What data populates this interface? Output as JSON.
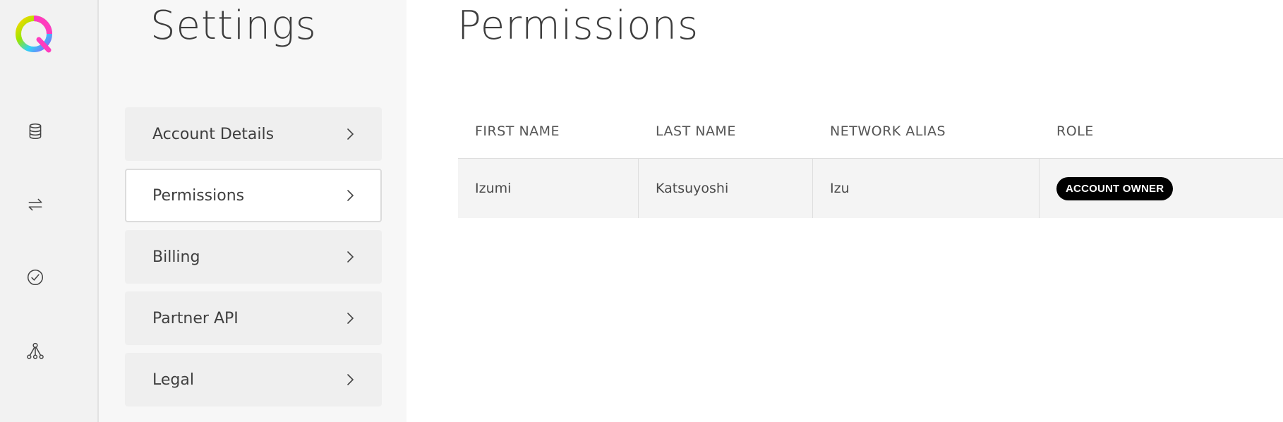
{
  "rail": {
    "icons": [
      "database-icon",
      "transfer-arrows-icon",
      "check-circle-icon",
      "network-icon"
    ]
  },
  "settings": {
    "title": "Settings",
    "items": [
      {
        "label": "Account Details",
        "active": false
      },
      {
        "label": "Permissions",
        "active": true
      },
      {
        "label": "Billing",
        "active": false
      },
      {
        "label": "Partner API",
        "active": false
      },
      {
        "label": "Legal",
        "active": false
      }
    ]
  },
  "main": {
    "title": "Permissions",
    "table": {
      "headers": [
        "FIRST NAME",
        "LAST NAME",
        "NETWORK ALIAS",
        "ROLE"
      ],
      "rows": [
        {
          "first_name": "Izumi",
          "last_name": "Katsuyoshi",
          "network_alias": "Izu",
          "role": "ACCOUNT OWNER"
        }
      ]
    }
  },
  "colors": {
    "rail_bg": "#f2f2f2",
    "panel_bg": "#f7f7f7",
    "badge_bg": "#000000",
    "logo_colors": [
      "#ff3cbe",
      "#2fd3f5",
      "#9be600",
      "#ffd600"
    ]
  }
}
